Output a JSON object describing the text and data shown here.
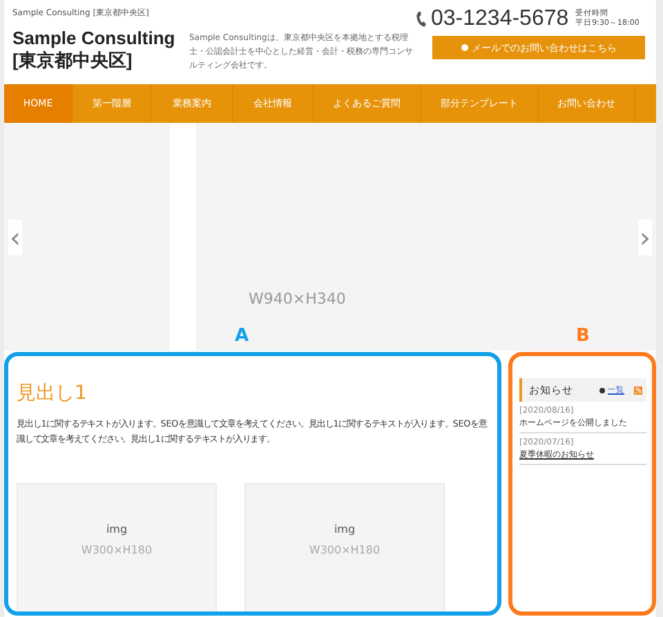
{
  "header": {
    "tagline": "Sample Consulting [東京都中央区]",
    "site_title": "Sample Consulting [東京都中央区]",
    "description": "Sample Consultingは、東京都中央区を本拠地とする税理士・公認会計士を中心とした経営・会計・税務の専門コンサルティング会社です。",
    "phone": "03-1234-5678",
    "hours_label": "受付時間",
    "hours": "平日9:30～18:00",
    "contact_button": "メールでのお問い合わせはこちら"
  },
  "nav": [
    {
      "label": "HOME",
      "selected": true
    },
    {
      "label": "第一階層",
      "selected": false
    },
    {
      "label": "業務案内",
      "selected": false
    },
    {
      "label": "会社情報",
      "selected": false
    },
    {
      "label": "よくあるご質問",
      "selected": false
    },
    {
      "label": "部分テンプレート",
      "selected": false
    },
    {
      "label": "お問い合わせ",
      "selected": false
    }
  ],
  "slider": {
    "prev": "‹",
    "next": "›",
    "size": "W940×H340"
  },
  "regions": [
    {
      "label": "A",
      "color": "#12a0e8"
    },
    {
      "label": "B",
      "color": "#ff7a1c"
    }
  ],
  "main": {
    "heading": "見出し1",
    "text": "見出し1に関するテキストが入ります。SEOを意識して文章を考えてください。見出し1に関するテキストが入ります。SEOを意識して文章を考えてください。見出し1に関するテキストが入ります。",
    "images": [
      {
        "label": "img",
        "size": "W300×H180"
      },
      {
        "label": "img",
        "size": "W300×H180"
      }
    ]
  },
  "sidebar": {
    "title": "お知らせ",
    "list_link": "一覧",
    "news": [
      {
        "date": "[2020/08/16]",
        "text": "ホームページを公開しました",
        "kind": "plain"
      },
      {
        "date": "[2020/07/16]",
        "text": "夏季休暇のお知らせ",
        "kind": "link"
      }
    ]
  }
}
